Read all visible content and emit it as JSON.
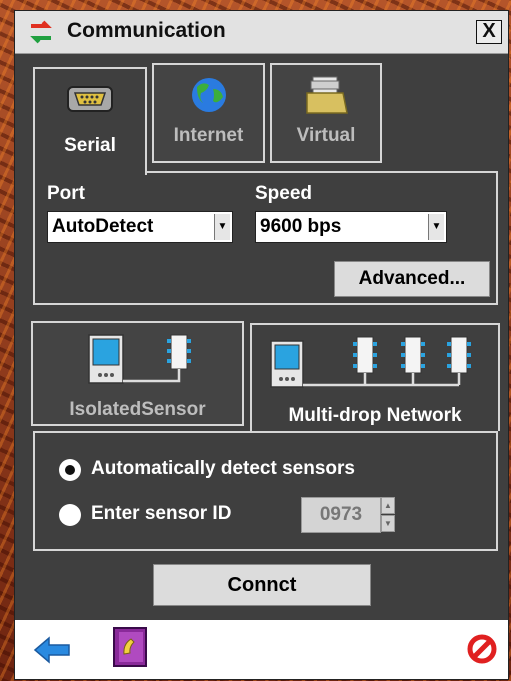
{
  "window": {
    "title": "Communication",
    "close_label": "X"
  },
  "connection_tabs": [
    {
      "label": "Serial",
      "icon": "serial-port-icon",
      "active": true
    },
    {
      "label": "Internet",
      "icon": "globe-icon",
      "active": false
    },
    {
      "label": "Virtual",
      "icon": "virtual-folder-icon",
      "active": false
    }
  ],
  "serial": {
    "port_label": "Port",
    "port_value": "AutoDetect",
    "speed_label": "Speed",
    "speed_value": "9600 bps",
    "advanced_label": "Advanced..."
  },
  "network_tabs": [
    {
      "label": "IsolatedSensor",
      "icon": "isolated-sensor-icon",
      "active": false
    },
    {
      "label": "Multi-drop Network",
      "icon": "multidrop-network-icon",
      "active": true
    }
  ],
  "multidrop": {
    "auto_detect_label": "Automatically detect sensors",
    "auto_detect_selected": true,
    "enter_id_label": "Enter sensor ID",
    "enter_id_selected": false,
    "sensor_id_value": "0973"
  },
  "connect_label": "Connct",
  "bottom_bar": {
    "icons": [
      "back-arrow-icon",
      "phonebook-icon",
      "cancel-icon"
    ]
  },
  "colors": {
    "window_bg": "#3f3f3f",
    "title_bg": "#e2e2e2",
    "accent_blue": "#2aa3e0"
  }
}
